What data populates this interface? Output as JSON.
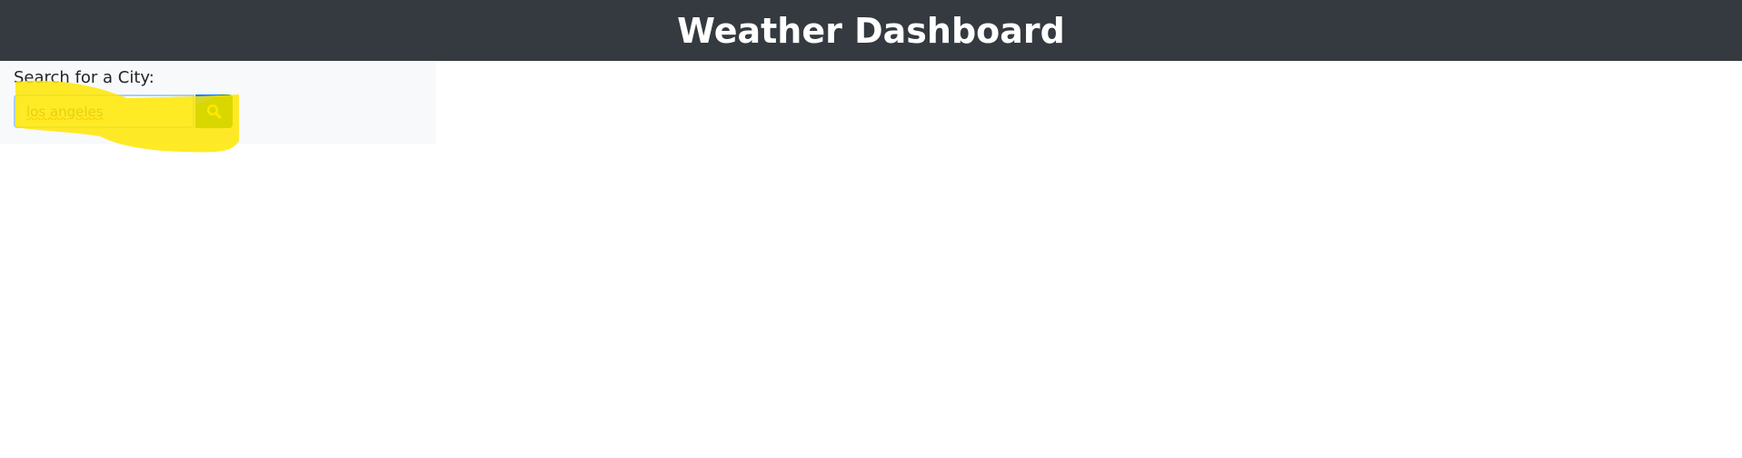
{
  "header": {
    "title": "Weather Dashboard"
  },
  "search": {
    "label": "Search for a City:",
    "value": "los angeles",
    "button_icon": "search-icon"
  },
  "colors": {
    "header_bg": "#343a40",
    "button": "#008000",
    "highlight": "#ffe600"
  }
}
